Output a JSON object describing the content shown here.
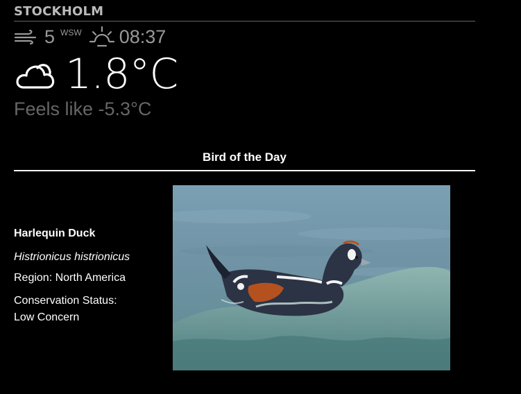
{
  "weather": {
    "city": "STOCKHOLM",
    "wind": {
      "speed": "5",
      "direction": "WSW",
      "icon": "wind-icon"
    },
    "sun": {
      "time": "08:37",
      "icon": "sunrise-icon"
    },
    "current": {
      "temperature": "1.8°C",
      "icon": "cloud-icon"
    },
    "feels_like": "Feels like -5.3°C"
  },
  "bird": {
    "header": "Bird of the Day",
    "name": "Harlequin Duck",
    "scientific_name": "Histrionicus histrionicus",
    "region": "Region: North America",
    "status_label": "Conservation Status:",
    "status_value": "Low Concern",
    "photo_subject": "harlequin-duck-photo"
  },
  "colors": {
    "background": "#000000",
    "primary_text": "#ffffff",
    "secondary_text": "#999999",
    "dim_text": "#666666"
  }
}
